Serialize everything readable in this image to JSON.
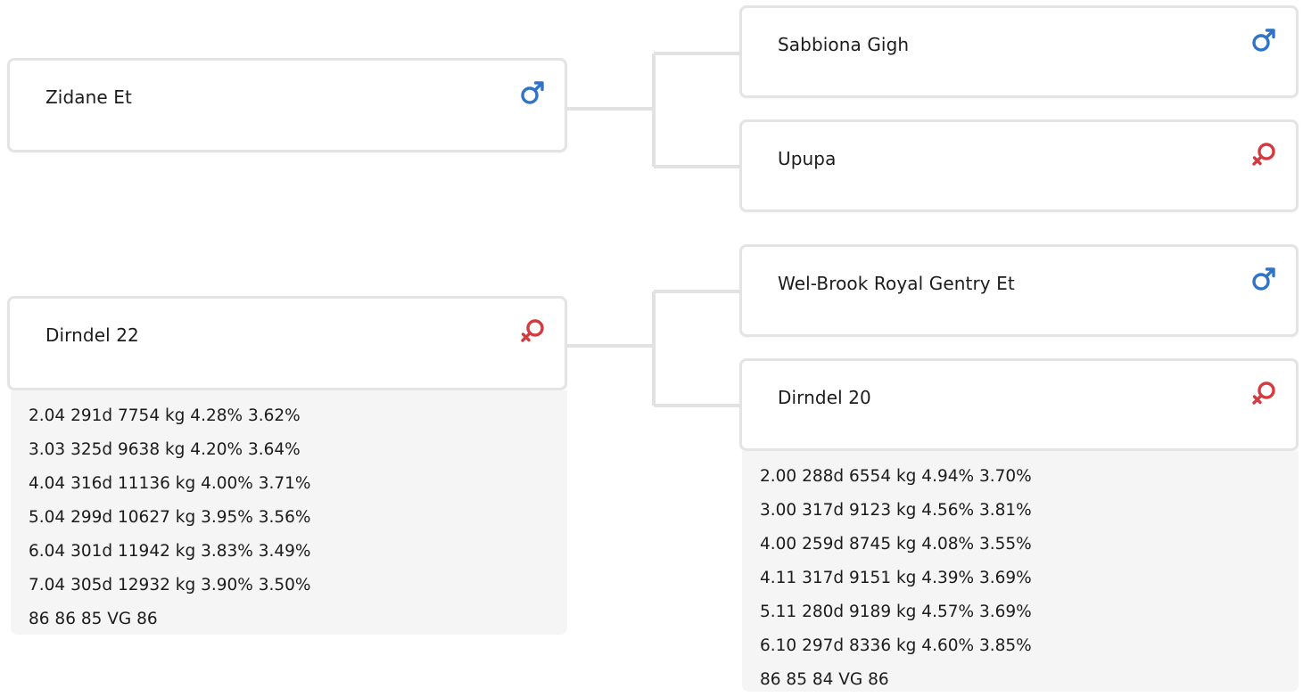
{
  "colors": {
    "male": "#2f74c8",
    "female": "#d43a3f",
    "line": "#e2e2e2"
  },
  "animals": {
    "sire": {
      "name": "Zidane Et",
      "sex": "male"
    },
    "dam": {
      "name": "Dirndel 22",
      "sex": "female",
      "records": [
        "2.04 291d 7754 kg 4.28% 3.62%",
        "3.03 325d 9638 kg 4.20% 3.64%",
        "4.04 316d 11136 kg 4.00% 3.71%",
        "5.04 299d 10627 kg 3.95% 3.56%",
        "6.04 301d 11942 kg 3.83% 3.49%",
        "7.04 305d 12932 kg 3.90% 3.50%",
        "86 86 85 VG 86"
      ]
    },
    "sire_sire": {
      "name": "Sabbiona Gigh",
      "sex": "male"
    },
    "sire_dam": {
      "name": "Upupa",
      "sex": "female"
    },
    "dam_sire": {
      "name": "Wel-Brook Royal Gentry Et",
      "sex": "male"
    },
    "dam_dam": {
      "name": "Dirndel 20",
      "sex": "female",
      "records": [
        "2.00 288d 6554 kg 4.94% 3.70%",
        "3.00 317d 9123 kg 4.56% 3.81%",
        "4.00 259d 8745 kg 4.08% 3.55%",
        "4.11 317d 9151 kg 4.39% 3.69%",
        "5.11 280d 9189 kg 4.57% 3.69%",
        "6.10 297d 8336 kg 4.60% 3.85%",
        "86 85 84 VG 86"
      ]
    }
  },
  "icons": {
    "male": "male-symbol-icon",
    "female": "female-symbol-icon"
  }
}
